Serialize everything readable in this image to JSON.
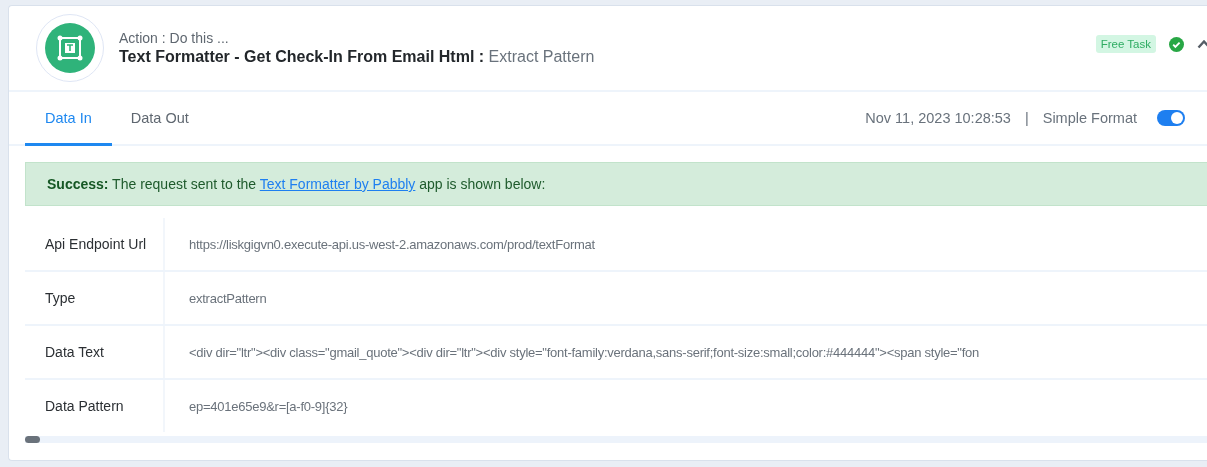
{
  "header": {
    "subtitle": "Action : Do this ...",
    "title": "Text Formatter - Get Check-In From Email Html :",
    "action": "Extract Pattern",
    "badge": "Free Task"
  },
  "tabs": [
    {
      "label": "Data In",
      "selected": true
    },
    {
      "label": "Data Out",
      "selected": false
    }
  ],
  "timestamp": "Nov 11, 2023 10:28:53",
  "separator": "|",
  "format_toggle": {
    "label": "Simple Format",
    "on": true
  },
  "alert": {
    "lead": "Success:",
    "before": "The request sent to the",
    "link": "Text Formatter by Pabbly",
    "after": "app is shown below:"
  },
  "rows": [
    {
      "label": "Api Endpoint Url",
      "value": "https://liskgigvn0.execute-api.us-west-2.amazonaws.com/prod/textFormat"
    },
    {
      "label": "Type",
      "value": "extractPattern"
    },
    {
      "label": "Data Text",
      "value": "<div dir=\"ltr\"><div class=\"gmail_quote\"><div dir=\"ltr\"><div style=\"font-family:verdana,sans-serif;font-size:small;color:#444444\"><span style=\"fon"
    },
    {
      "label": "Data Pattern",
      "value": "ep=401e65e9&r=[a-f0-9]{32}"
    }
  ]
}
